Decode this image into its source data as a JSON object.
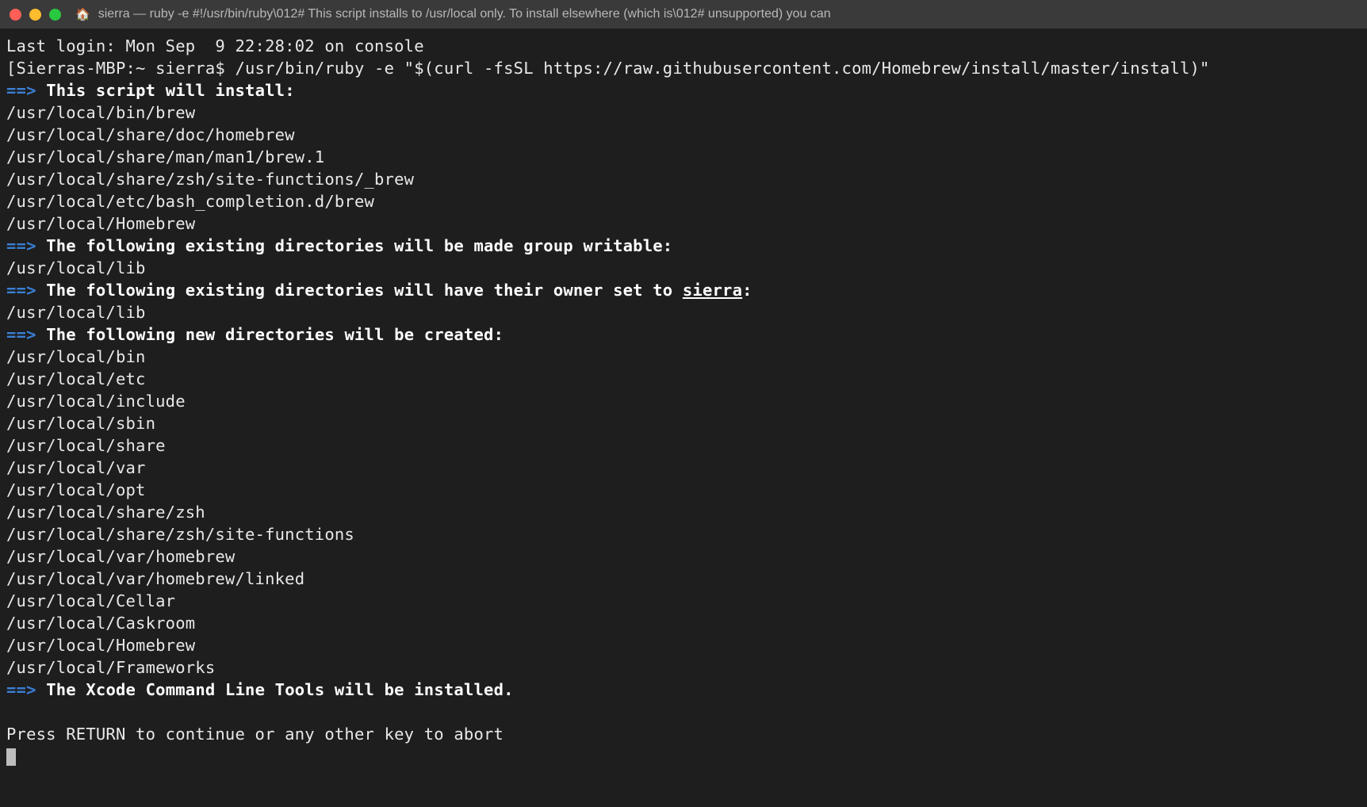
{
  "titlebar": {
    "title": "sierra — ruby -e #!/usr/bin/ruby\\012# This script installs to /usr/local only. To install elsewhere (which is\\012# unsupported) you can"
  },
  "terminal": {
    "last_login": "Last login: Mon Sep  9 22:28:02 on console",
    "prompt_prefix": "[Sierras-MBP:~ sierra$ ",
    "command": "/usr/bin/ruby -e \"$(curl -fsSL https://raw.githubusercontent.com/Homebrew/install/master/install)\"",
    "arrow": "==>",
    "heading_install": "This script will install:",
    "install_paths": [
      "/usr/local/bin/brew",
      "/usr/local/share/doc/homebrew",
      "/usr/local/share/man/man1/brew.1",
      "/usr/local/share/zsh/site-functions/_brew",
      "/usr/local/etc/bash_completion.d/brew",
      "/usr/local/Homebrew"
    ],
    "heading_group_writable": "The following existing directories will be made group writable:",
    "group_writable_paths": [
      "/usr/local/lib"
    ],
    "heading_owner_prefix": "The following existing directories will have their owner set to ",
    "owner_user": "sierra",
    "heading_owner_suffix": ":",
    "owner_paths": [
      "/usr/local/lib"
    ],
    "heading_new_dirs": "The following new directories will be created:",
    "new_dir_paths": [
      "/usr/local/bin",
      "/usr/local/etc",
      "/usr/local/include",
      "/usr/local/sbin",
      "/usr/local/share",
      "/usr/local/var",
      "/usr/local/opt",
      "/usr/local/share/zsh",
      "/usr/local/share/zsh/site-functions",
      "/usr/local/var/homebrew",
      "/usr/local/var/homebrew/linked",
      "/usr/local/Cellar",
      "/usr/local/Caskroom",
      "/usr/local/Homebrew",
      "/usr/local/Frameworks"
    ],
    "heading_xcode": "The Xcode Command Line Tools will be installed.",
    "press_return": "Press RETURN to continue or any other key to abort"
  }
}
